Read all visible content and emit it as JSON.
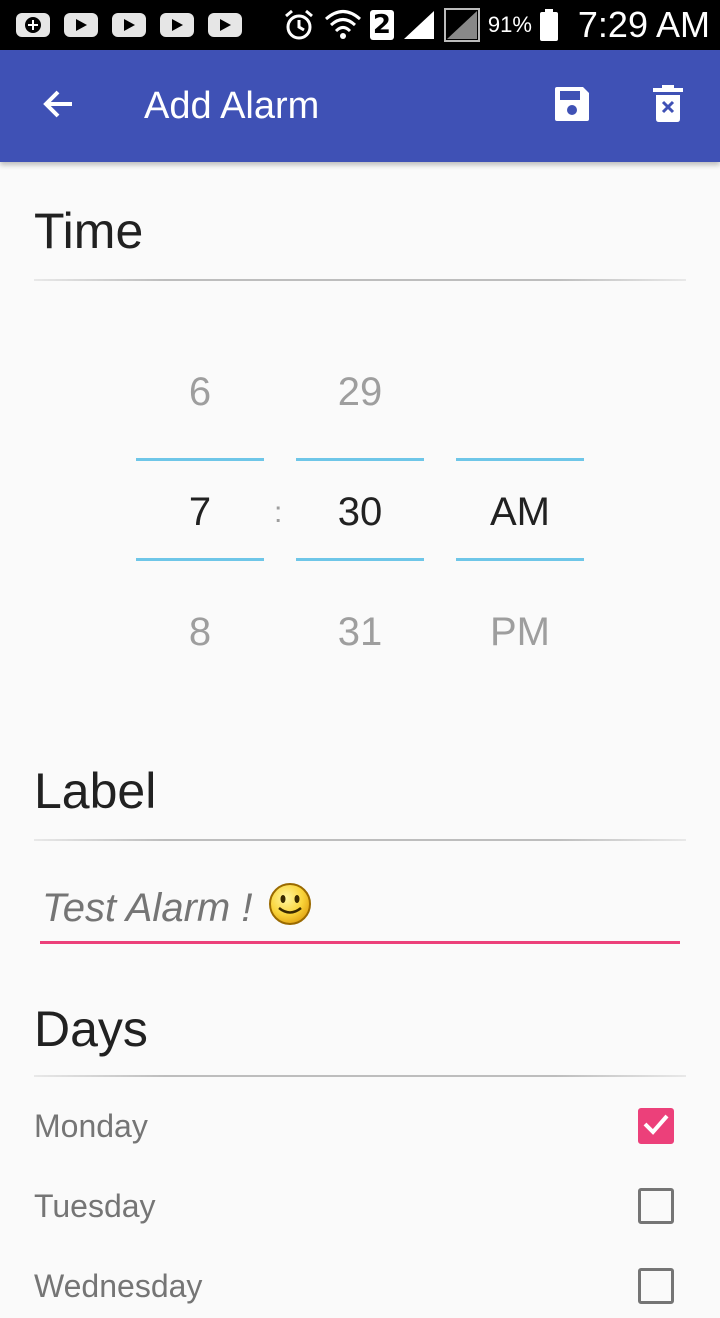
{
  "status_bar": {
    "badge": "2",
    "battery": "91%",
    "time": "7:29 AM"
  },
  "app_bar": {
    "title": "Add Alarm",
    "back_icon": "arrow-left-icon",
    "save_icon": "save-icon",
    "delete_icon": "delete-icon"
  },
  "time_section": {
    "title": "Time",
    "hour": {
      "prev": "6",
      "selected": "7",
      "next": "8"
    },
    "separator": ":",
    "minute": {
      "prev": "29",
      "selected": "30",
      "next": "31"
    },
    "ampm": {
      "prev": "",
      "selected": "AM",
      "next": "PM"
    },
    "accent": "#6ec6e8"
  },
  "label_section": {
    "title": "Label",
    "value": "Test Alarm !",
    "accent": "#ec407a"
  },
  "days_section": {
    "title": "Days",
    "days": [
      {
        "label": "Monday",
        "checked": true
      },
      {
        "label": "Tuesday",
        "checked": false
      },
      {
        "label": "Wednesday",
        "checked": false
      }
    ]
  },
  "colors": {
    "primary": "#3f51b5",
    "accent": "#ec407a"
  }
}
